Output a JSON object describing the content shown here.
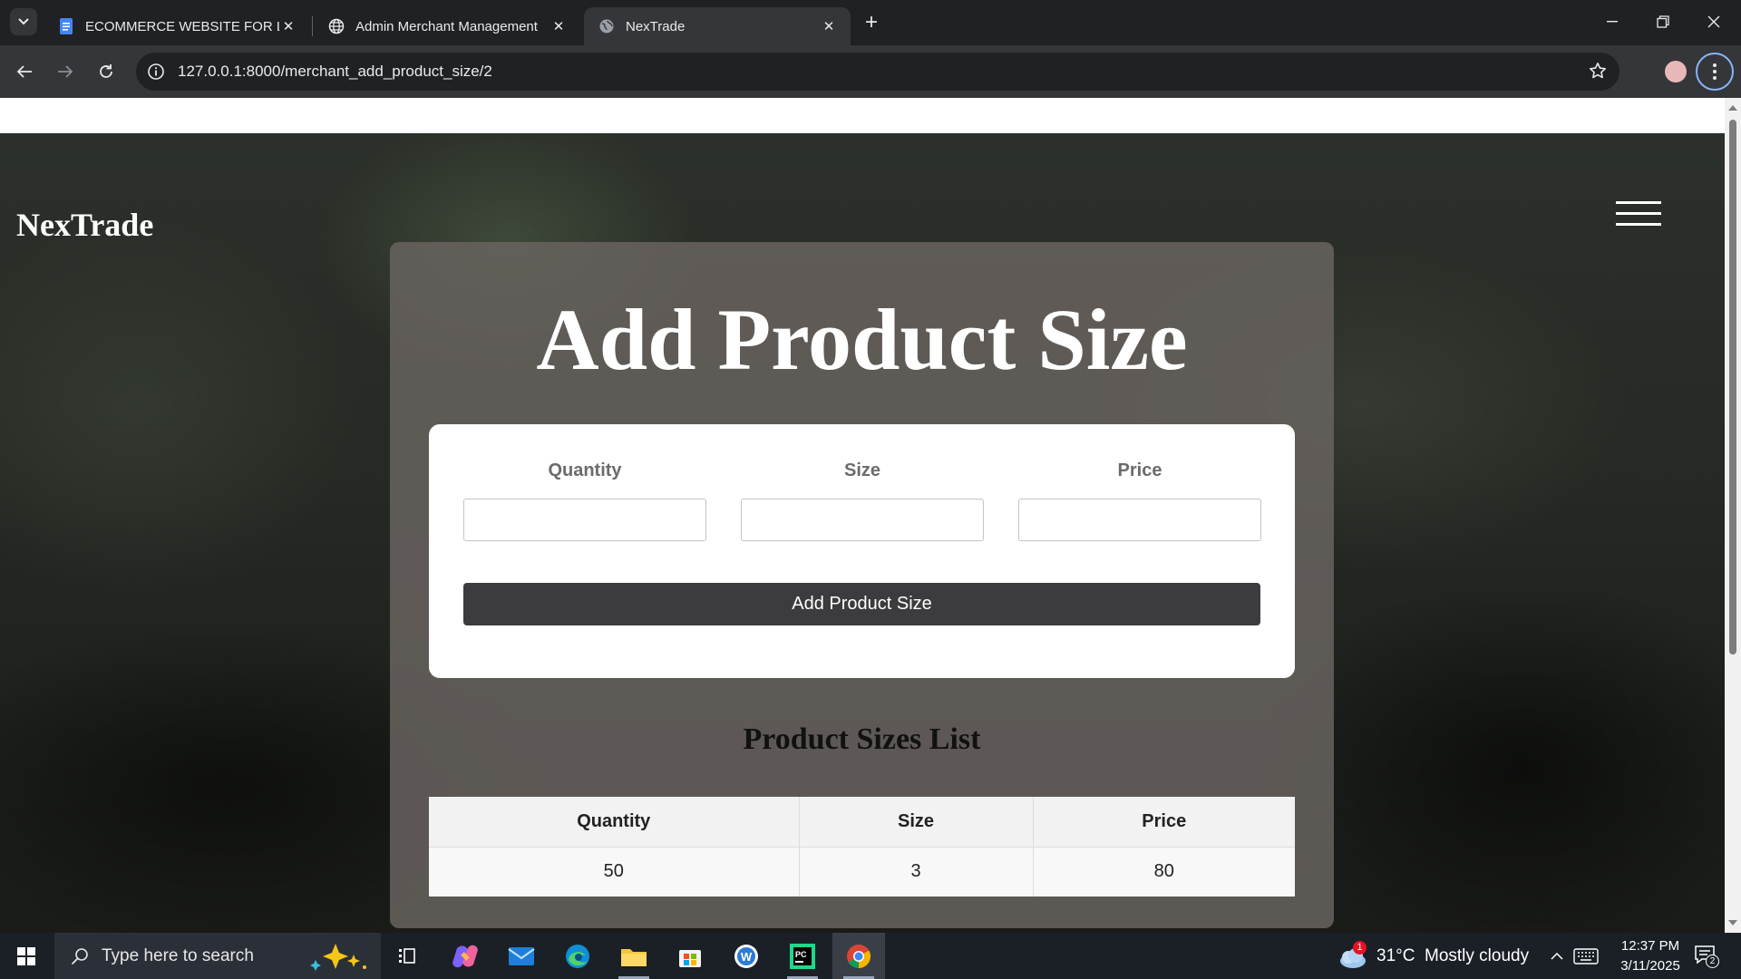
{
  "browser": {
    "tabs": [
      {
        "title": "ECOMMERCE WEBSITE FOR LOCAL",
        "icon": "docs-icon"
      },
      {
        "title": "Admin Merchant Management",
        "icon": "globe-icon"
      },
      {
        "title": "NexTrade",
        "icon": "globe-icon",
        "active": true
      }
    ],
    "url": "127.0.0.1:8000/merchant_add_product_size/2"
  },
  "page": {
    "brand": "NexTrade",
    "title": "Add Product Size",
    "form": {
      "quantity_label": "Quantity",
      "size_label": "Size",
      "price_label": "Price",
      "submit_label": "Add Product Size"
    },
    "list": {
      "title": "Product Sizes List",
      "headers": [
        "Quantity",
        "Size",
        "Price"
      ],
      "rows": [
        [
          "50",
          "3",
          "80"
        ]
      ]
    }
  },
  "taskbar": {
    "search_placeholder": "Type here to search",
    "weather": "31°C  Mostly cloudy",
    "weather_badge": "1",
    "time": "12:37 PM",
    "date": "3/11/2025",
    "notification_count": "2"
  },
  "colors": {
    "panel": "#68635f",
    "button": "#3c3c3e",
    "chrome_dark": "#202124",
    "chrome_toolbar": "#35363a"
  }
}
